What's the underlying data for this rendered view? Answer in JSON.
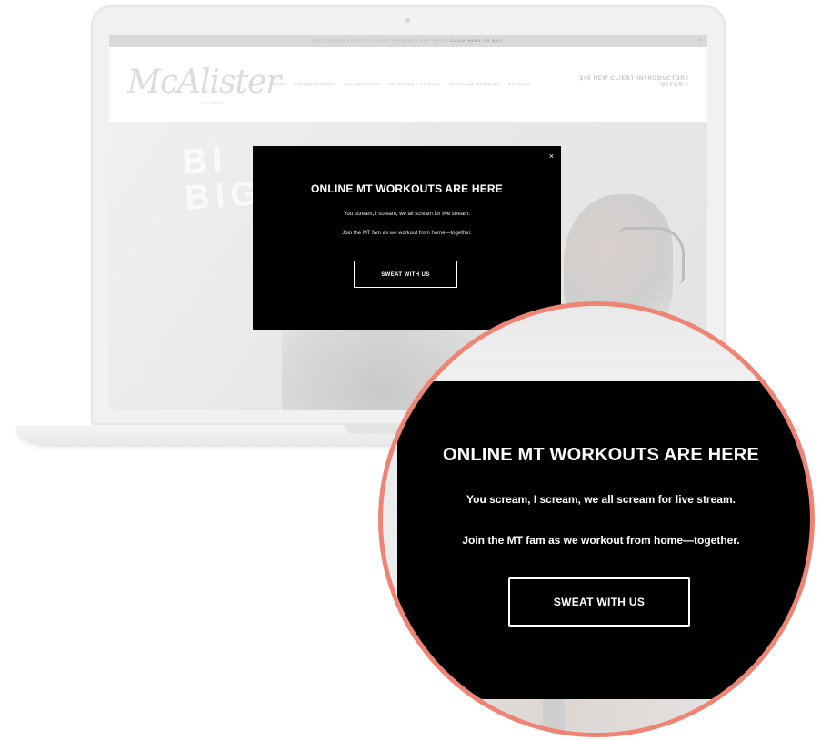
{
  "announcement": {
    "text": "DISCOUNTED COVID-19 CLASS PACKAGES ARE HERE.",
    "link": "CLICK HERE TO BUY.",
    "close": "×"
  },
  "header": {
    "logo": "McAlister",
    "logo_sub": "TRAINING",
    "nav": [
      "ABOUT",
      "ONLINE CLASSES",
      "ONLINE STORE",
      "SCHEDULE + PRICING",
      "PERSONAL TRAINING",
      "CONTACT"
    ],
    "offer": "$45 NEW CLIENT INTRODUCTORY OFFER >"
  },
  "hero": {
    "line1": "BI",
    "line2": "BIG"
  },
  "modal": {
    "close": "×",
    "title": "ONLINE MT WORKOUTS ARE HERE",
    "line1": "You scream, I scream, we all scream for live stream.",
    "line2": "Join the MT fam as we workout from home—together.",
    "button": "SWEAT WITH US"
  },
  "colors": {
    "zoom_ring": "#ef8474",
    "modal_bg": "#000000"
  }
}
